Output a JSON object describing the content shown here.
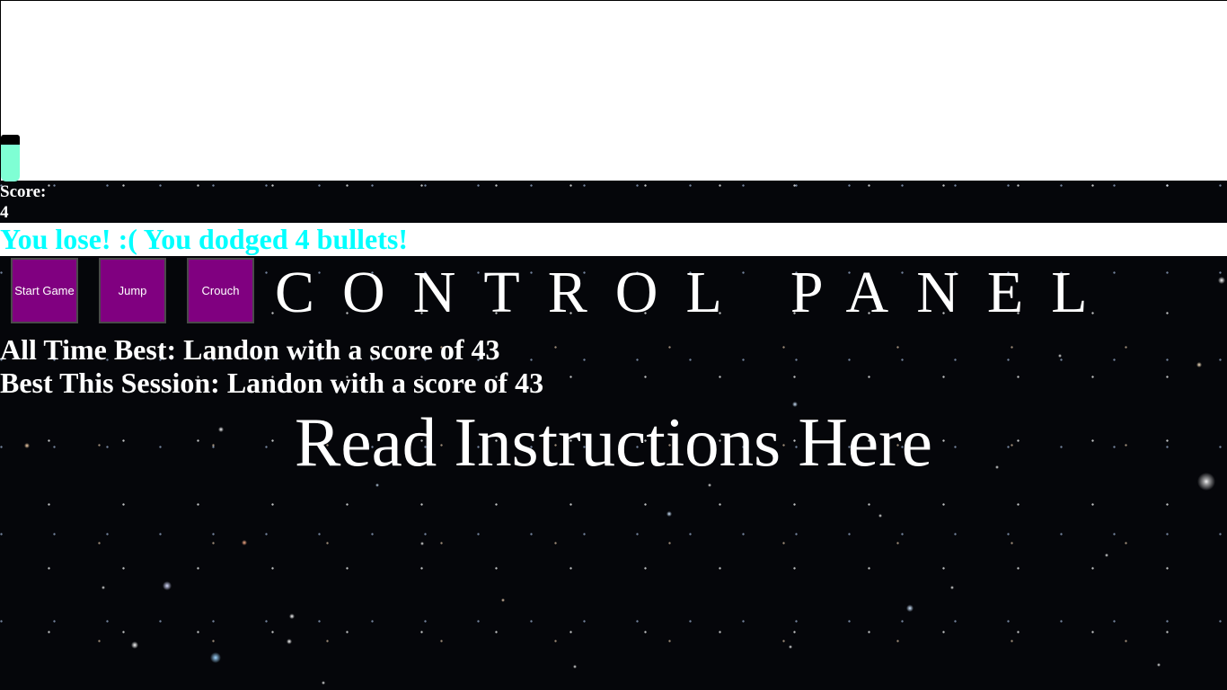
{
  "game": {
    "player": {
      "head_color": "#000000",
      "body_color": "#7fffd4"
    }
  },
  "score": {
    "label": "Score:",
    "value": "4"
  },
  "message": {
    "text": "You lose! :( You dodged 4 bullets!",
    "color": "#00ffff"
  },
  "controls": {
    "start_label": "Start Game",
    "jump_label": "Jump",
    "crouch_label": "Crouch",
    "button_color": "#800080"
  },
  "panel": {
    "title": "CONTROL PANEL"
  },
  "leaderboard": {
    "all_time": "All Time Best: Landon with a score of 43",
    "session": "Best This Session: Landon with a score of 43"
  },
  "instructions": {
    "link_text": "Read Instructions Here"
  },
  "background": "starfield"
}
